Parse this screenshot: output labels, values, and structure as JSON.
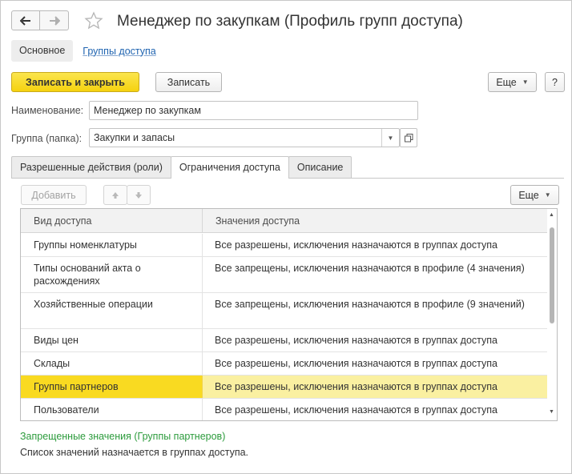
{
  "window": {
    "title": "Менеджер по закупкам (Профиль групп доступа)"
  },
  "sections": {
    "main": "Основное",
    "access_groups": "Группы доступа"
  },
  "toolbar": {
    "save_close": "Записать и закрыть",
    "save": "Записать",
    "more": "Еще",
    "help": "?"
  },
  "form": {
    "name_label": "Наименование:",
    "name_value": "Менеджер по закупкам",
    "group_label": "Группа (папка):",
    "group_value": "Закупки и запасы"
  },
  "tabs": [
    {
      "label": "Разрешенные действия (роли)"
    },
    {
      "label": "Ограничения доступа"
    },
    {
      "label": "Описание"
    }
  ],
  "table_toolbar": {
    "add": "Добавить",
    "more": "Еще"
  },
  "table": {
    "columns": [
      "Вид доступа",
      "Значения доступа"
    ],
    "rows": [
      {
        "kind": "Группы номенклатуры",
        "values": "Все разрешены, исключения назначаются в группах доступа"
      },
      {
        "kind": "Типы оснований акта о расхождениях",
        "values": "Все запрещены, исключения назначаются в профиле (4 значения)"
      },
      {
        "kind": "Хозяйственные операции",
        "values": "Все запрещены, исключения назначаются в профиле (9 значений)"
      },
      {
        "kind": "Виды цен",
        "values": "Все разрешены, исключения назначаются в группах доступа"
      },
      {
        "kind": "Склады",
        "values": "Все разрешены, исключения назначаются в группах доступа"
      },
      {
        "kind": "Группы партнеров",
        "values": "Все разрешены, исключения назначаются в группах доступа"
      },
      {
        "kind": "Пользователи",
        "values": "Все разрешены, исключения назначаются в группах доступа"
      }
    ]
  },
  "footer": {
    "title": "Запрещенные значения (Группы партнеров)",
    "note": "Список значений назначается в группах доступа."
  },
  "colors": {
    "accent": "#f5d20f",
    "selected_row": "#faf0a1",
    "link": "#1e63b0",
    "green": "#2c9b3c"
  }
}
